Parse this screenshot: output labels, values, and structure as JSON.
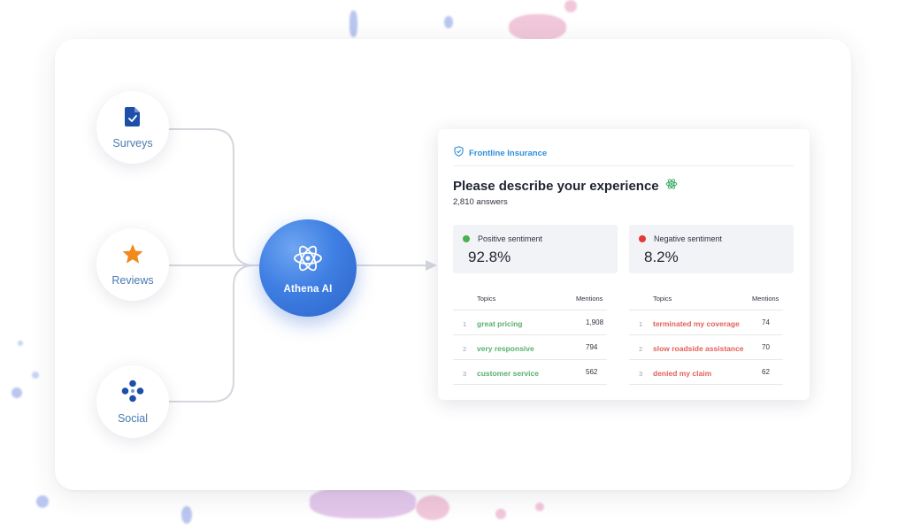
{
  "sources": [
    {
      "label": "Surveys",
      "icon": "survey-document-icon"
    },
    {
      "label": "Reviews",
      "icon": "star-icon"
    },
    {
      "label": "Social",
      "icon": "social-nodes-icon"
    }
  ],
  "hub": {
    "label": "Athena AI",
    "icon": "atom-icon"
  },
  "panel": {
    "brand": "Frontline Insurance",
    "question": "Please describe your experience",
    "answers": "2,810 answers",
    "positive": {
      "label": "Positive sentiment",
      "value": "92.8%",
      "color": "#4caf50"
    },
    "negative": {
      "label": "Negative sentiment",
      "value": "8.2%",
      "color": "#e53935"
    },
    "positive_table": {
      "col_topics": "Topics",
      "col_mentions": "Mentions",
      "rows": [
        {
          "num": "1",
          "topic": "great pricing",
          "mentions": "1,908"
        },
        {
          "num": "2",
          "topic": "very responsive",
          "mentions": "794"
        },
        {
          "num": "3",
          "topic": "customer service",
          "mentions": "562"
        }
      ]
    },
    "negative_table": {
      "col_topics": "Topics",
      "col_mentions": "Mentions",
      "rows": [
        {
          "num": "1",
          "topic": "terminated my coverage",
          "mentions": "74"
        },
        {
          "num": "2",
          "topic": "slow roadside assistance",
          "mentions": "70"
        },
        {
          "num": "3",
          "topic": "denied my claim",
          "mentions": "62"
        }
      ]
    }
  },
  "colors": {
    "accent_blue": "#3f7fe3",
    "positive_text": "#58b06e",
    "negative_text": "#e25f5a",
    "star": "#f08a1a",
    "icon_navy": "#1e4fa8"
  }
}
